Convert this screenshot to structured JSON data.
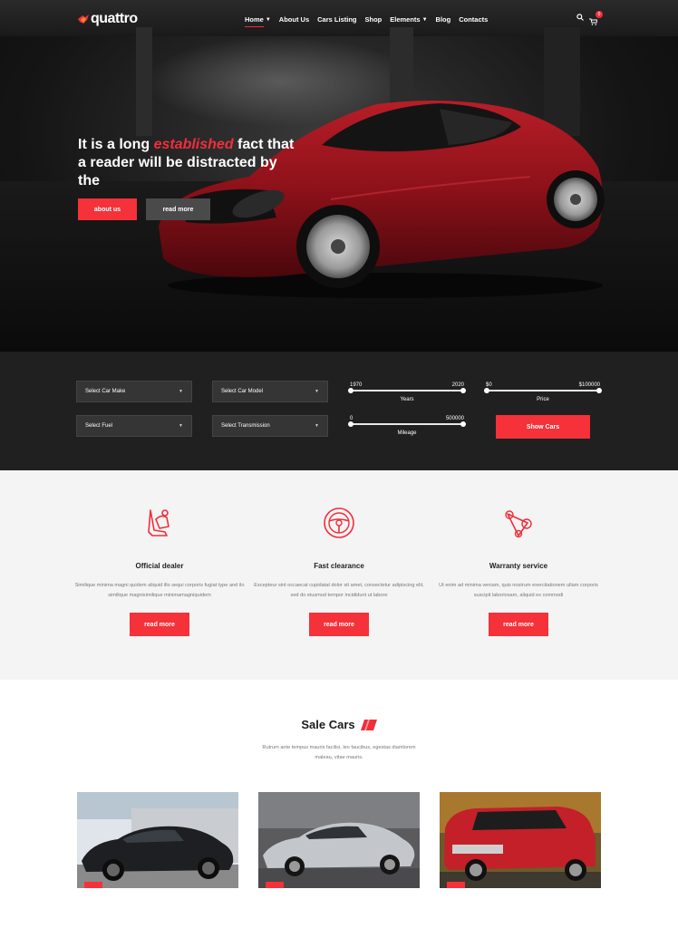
{
  "brand": {
    "name": "quattro",
    "accent": "#f02e3a"
  },
  "nav": {
    "items": [
      {
        "label": "Home",
        "caret": true
      },
      {
        "label": "About Us",
        "caret": false
      },
      {
        "label": "Cars Listing",
        "caret": false
      },
      {
        "label": "Shop",
        "caret": false
      },
      {
        "label": "Elements",
        "caret": true
      },
      {
        "label": "Blog",
        "caret": false
      },
      {
        "label": "Contacts",
        "caret": false
      }
    ],
    "cart_count": "0",
    "icons": [
      "search-icon",
      "cart-icon"
    ]
  },
  "hero": {
    "title_pre": "It is a long ",
    "title_accent": "established",
    "title_post": " fact that a reader will be distracted by the",
    "btn_primary": "about us",
    "btn_secondary": "read more"
  },
  "search": {
    "selects": [
      "Select Car Make",
      "Select Car Model",
      "Select Fuel",
      "Select Transmission"
    ],
    "years": {
      "min": "1970",
      "max": "2020",
      "label": "Years"
    },
    "price": {
      "min": "$0",
      "max": "$100000",
      "label": "Price"
    },
    "mileage": {
      "min": "0",
      "max": "500000",
      "label": "Mileage"
    },
    "submit": "Show Cars"
  },
  "features": [
    {
      "icon": "car-seat-icon",
      "title": "Official dealer",
      "desc": "Similique minima magni quidem aliquid illo sequi corporis fugiat type and ilo similique magnisimilique minimamagniquidem",
      "btn": "read more"
    },
    {
      "icon": "steering-wheel-icon",
      "title": "Fast clearance",
      "desc": "Excepteur sint occaecat cupidatat dolor sit amet, consectetur adipiscing elit, sed do eiusmod tempor incididunt ut labore",
      "btn": "read more"
    },
    {
      "icon": "timing-belt-icon",
      "title": "Warranty service",
      "desc": "Ut enim ad minima veniam, quis nostrum exercitationem ullam corporis suscipit laboriosam, aliquid ex commodi",
      "btn": "read more"
    }
  ],
  "sale": {
    "title": "Sale Cars",
    "subtitle": "Rutrum ante tempus mauris facilisi, leo faucibus, egestas diamlorem maleau, vitae mauris."
  }
}
